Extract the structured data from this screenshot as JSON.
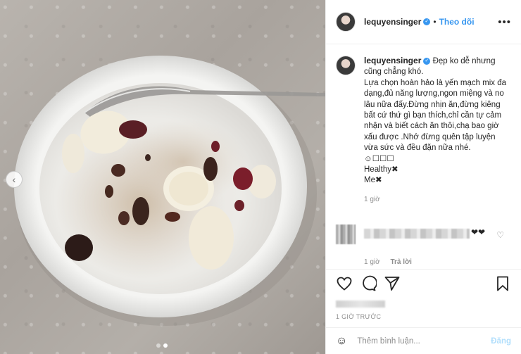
{
  "post": {
    "username": "lequyensinger",
    "separator": "•",
    "follow_label": "Theo dõi",
    "more_label": "•••",
    "caption": "Đẹp ko dễ nhưng cũng chẳng khó.\nLựa chọn hoàn hảo là yến mạch mix đa dạng,đủ năng lượng,ngon miệng và no lâu nữa đấy.Đừng nhịn ăn,đừng kiêng bất cứ thứ gì bạn thích,chỉ cần tự cảm nhận và biết cách ăn thôi,chạ bao giờ xấu được .Nhớ đừng quên tập luyện vừa sức và đều đặn nữa nhé.\n☺☐☐☐\nHealthy✖\nMe✖",
    "caption_age": "1 giờ"
  },
  "comment": {
    "emoji": "❤❤",
    "age": "1 giờ",
    "reply_label": "Trả lời"
  },
  "actions": {
    "time_ago": "1 GIỜ TRƯỚC"
  },
  "composer": {
    "placeholder": "Thêm bình luận...",
    "post_label": "Đăng"
  },
  "icons": [
    "chevron-left-icon",
    "heart-icon",
    "comment-icon",
    "share-icon",
    "bookmark-icon",
    "emoji-icon",
    "verified-badge-icon"
  ],
  "colors": {
    "link": "#3897f0",
    "post_disabled": "#b2dffc",
    "muted": "#8e8e8e"
  }
}
